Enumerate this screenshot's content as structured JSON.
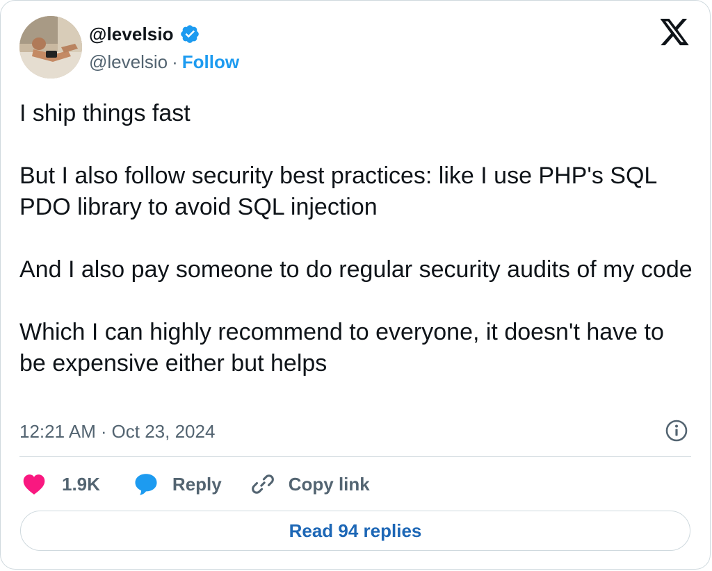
{
  "author": {
    "display_name": "@levelsio",
    "handle": "@levelsio",
    "separator": "·",
    "follow_label": "Follow"
  },
  "tweet": {
    "paragraphs": [
      "I ship things fast",
      "But I also follow security best practices: like I use PHP's SQL PDO library to avoid SQL injection",
      "And I also pay someone to do regular security audits of my code",
      "Which I can highly recommend to everyone, it doesn't have to be expensive either but helps"
    ],
    "time": "12:21 AM",
    "separator": "·",
    "date": "Oct 23, 2024"
  },
  "actions": {
    "like_count": "1.9K",
    "reply_label": "Reply",
    "copy_link_label": "Copy link"
  },
  "read_replies_label": "Read 94 replies",
  "icons": {
    "verified": "verified-badge-icon",
    "platform": "x-logo-icon",
    "info": "info-icon",
    "like": "heart-icon",
    "reply": "speech-bubble-icon",
    "copy": "link-icon"
  },
  "colors": {
    "accent": "#1d9bf0",
    "like": "#f91880",
    "secondary_text": "#536471",
    "primary_text": "#0f1419",
    "border": "#cfd9de"
  }
}
